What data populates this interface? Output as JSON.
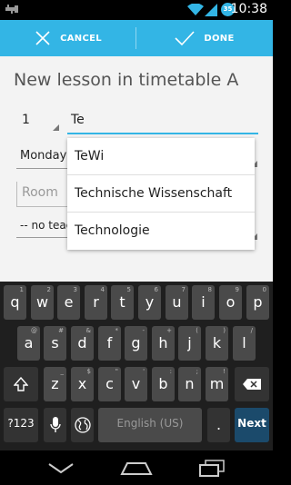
{
  "status_bar": {
    "clock": "10:38",
    "sync_badge": "35",
    "icons": [
      "usb-icon",
      "wifi-icon",
      "signal-icon",
      "sync-badge"
    ]
  },
  "action_bar": {
    "cancel_label": "CANCEL",
    "done_label": "DONE",
    "accent_color": "#33b5e5"
  },
  "form": {
    "title": "New lesson in timetable A",
    "lesson_number": "1",
    "lesson_name": "Te",
    "day": "Monday",
    "room_placeholder": "Room",
    "teacher": "-- no teacher --"
  },
  "suggestions": [
    "TeWi",
    "Technische Wissenschaft",
    "Technologie"
  ],
  "keyboard": {
    "row1": [
      {
        "key": "q",
        "sub": "1"
      },
      {
        "key": "w",
        "sub": "2"
      },
      {
        "key": "e",
        "sub": "3"
      },
      {
        "key": "r",
        "sub": "4"
      },
      {
        "key": "t",
        "sub": "5"
      },
      {
        "key": "y",
        "sub": "6"
      },
      {
        "key": "u",
        "sub": "7"
      },
      {
        "key": "i",
        "sub": "8"
      },
      {
        "key": "o",
        "sub": "9"
      },
      {
        "key": "p",
        "sub": "0"
      }
    ],
    "row2": [
      {
        "key": "a",
        "sub": "@"
      },
      {
        "key": "s",
        "sub": "#"
      },
      {
        "key": "d",
        "sub": "&"
      },
      {
        "key": "f",
        "sub": "*"
      },
      {
        "key": "g",
        "sub": "-"
      },
      {
        "key": "h",
        "sub": "+"
      },
      {
        "key": "j",
        "sub": "("
      },
      {
        "key": "k",
        "sub": ")"
      },
      {
        "key": "l",
        "sub": "/"
      }
    ],
    "row3": [
      {
        "key": "z",
        "sub": "_"
      },
      {
        "key": "x",
        "sub": "$"
      },
      {
        "key": "c",
        "sub": "\""
      },
      {
        "key": "v",
        "sub": "'"
      },
      {
        "key": "b",
        "sub": ":"
      },
      {
        "key": "n",
        "sub": ";"
      },
      {
        "key": "m",
        "sub": "!"
      }
    ],
    "symbols_label": "?123",
    "space_label": "English (US)",
    "period_label": ".",
    "next_label": "Next"
  }
}
